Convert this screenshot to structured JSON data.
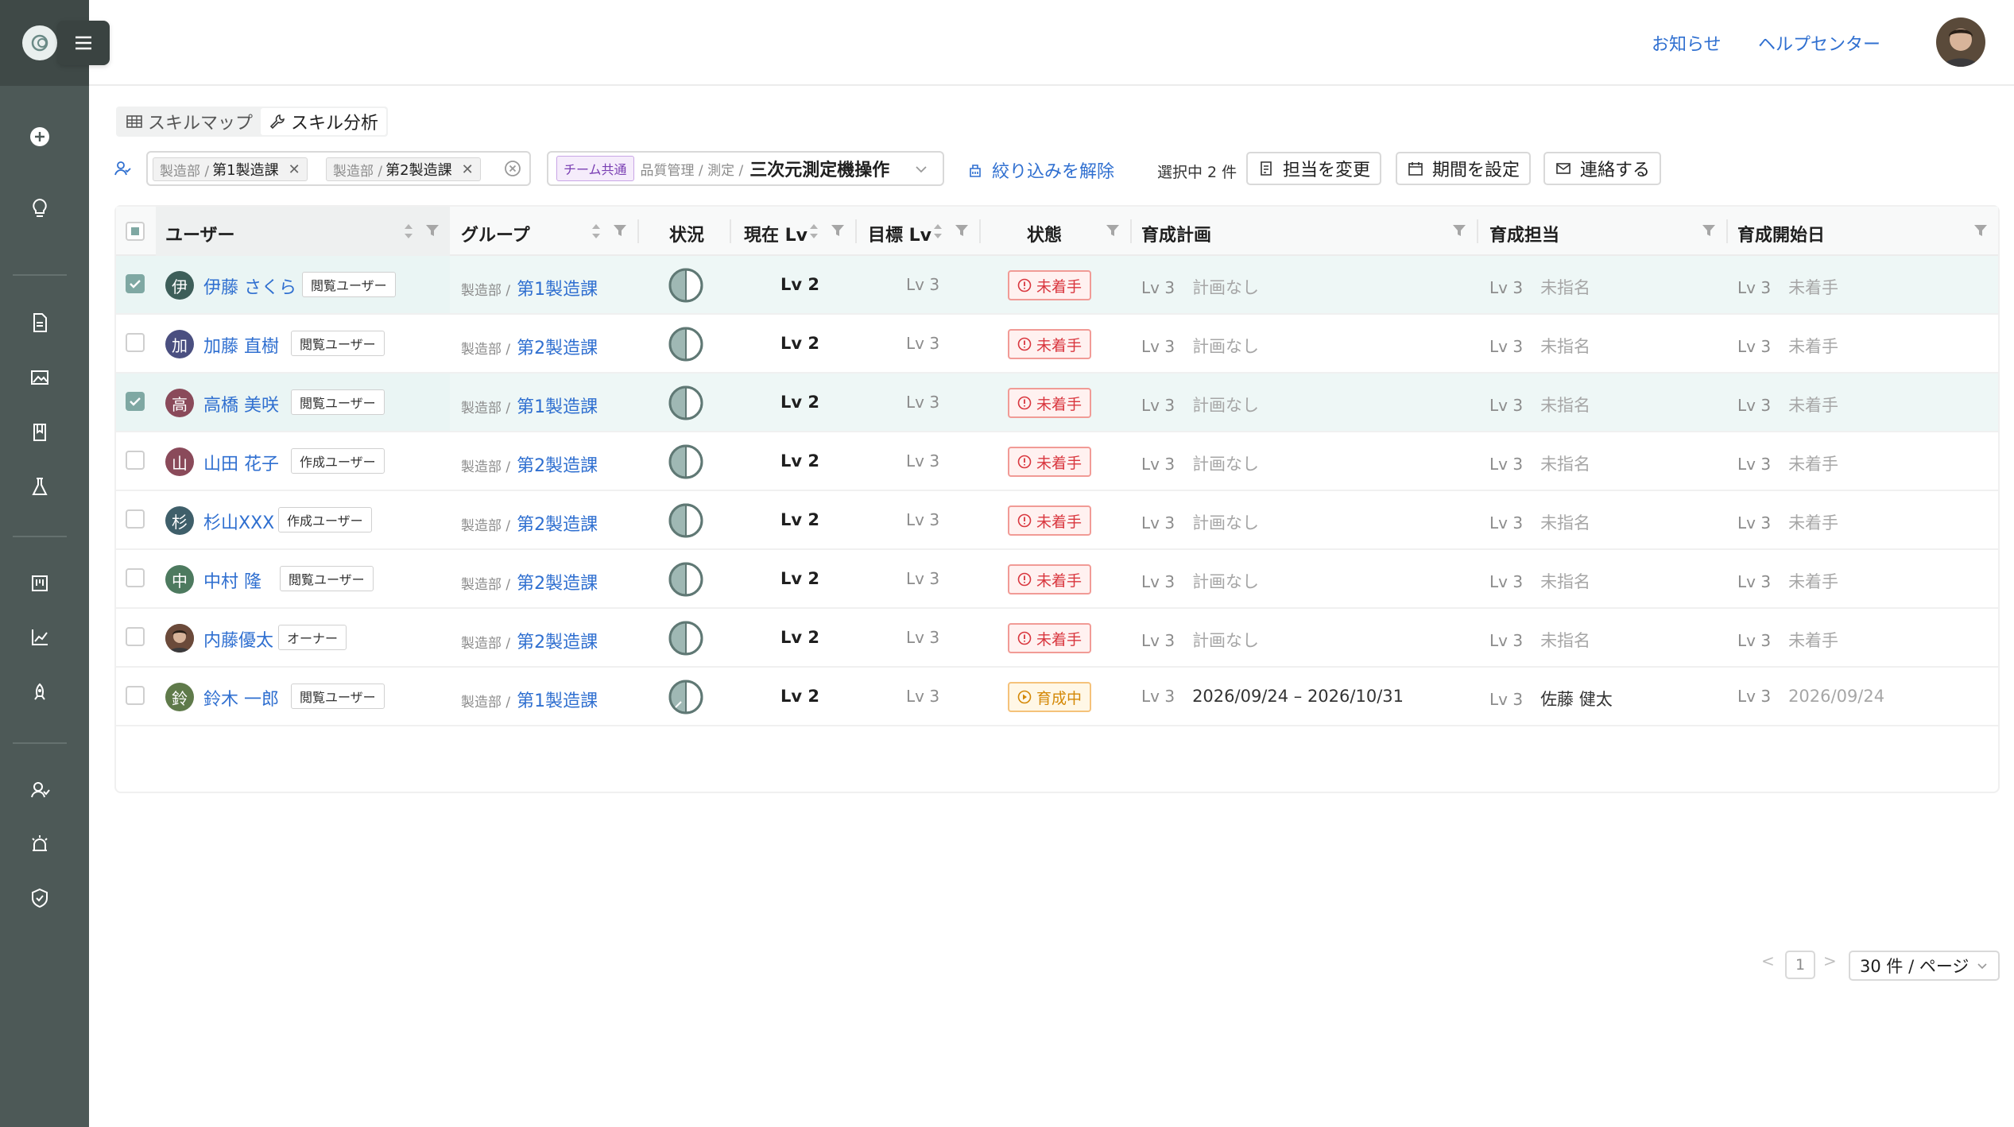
{
  "header": {
    "notice_label": "お知らせ",
    "help_label": "ヘルプセンター"
  },
  "tabs": [
    {
      "label": "スキルマップ"
    },
    {
      "label": "スキル分析"
    }
  ],
  "filters": {
    "group_chips": [
      {
        "path": "製造部 /",
        "name": "第1製造課"
      },
      {
        "path": "製造部 /",
        "name": "第2製造課"
      }
    ],
    "skill": {
      "badge": "チーム共通",
      "path": "品質管理 / 測定 /",
      "name": "三次元測定機操作"
    },
    "reset_label": "絞り込みを解除"
  },
  "actions": {
    "selected_count": "選択中 2 件",
    "change_owner": "担当を変更",
    "set_period": "期間を設定",
    "contact": "連絡する"
  },
  "table": {
    "columns": [
      "ユーザー",
      "グループ",
      "状況",
      "現在 Lv",
      "目標 Lv",
      "状態",
      "育成計画",
      "育成担当",
      "育成開始日"
    ],
    "rows": [
      {
        "initial": "伊",
        "name": "伊藤 さくら",
        "role": "閲覧ユーザー",
        "dept": "製造部 /",
        "group": "第1製造課",
        "current": "Lv 2",
        "target": "Lv 3",
        "status": "未着手",
        "plan_lv": "Lv 3",
        "plan": "計画なし",
        "owner_lv": "Lv 3",
        "owner": "未指名",
        "start_lv": "Lv 3",
        "start": "未着手",
        "selected": true,
        "progress": 0.5,
        "avatar_color": "#3d5e59"
      },
      {
        "initial": "加",
        "name": "加藤 直樹",
        "role": "閲覧ユーザー",
        "dept": "製造部 /",
        "group": "第2製造課",
        "current": "Lv 2",
        "target": "Lv 3",
        "status": "未着手",
        "plan_lv": "Lv 3",
        "plan": "計画なし",
        "owner_lv": "Lv 3",
        "owner": "未指名",
        "start_lv": "Lv 3",
        "start": "未着手",
        "selected": false,
        "progress": 0.5,
        "avatar_color": "#4a4f80"
      },
      {
        "initial": "高",
        "name": "高橋 美咲",
        "role": "閲覧ユーザー",
        "dept": "製造部 /",
        "group": "第1製造課",
        "current": "Lv 2",
        "target": "Lv 3",
        "status": "未着手",
        "plan_lv": "Lv 3",
        "plan": "計画なし",
        "owner_lv": "Lv 3",
        "owner": "未指名",
        "start_lv": "Lv 3",
        "start": "未着手",
        "selected": true,
        "progress": 0.5,
        "avatar_color": "#8a4a5a"
      },
      {
        "initial": "山",
        "name": "山田 花子",
        "role": "作成ユーザー",
        "dept": "製造部 /",
        "group": "第2製造課",
        "current": "Lv 2",
        "target": "Lv 3",
        "status": "未着手",
        "plan_lv": "Lv 3",
        "plan": "計画なし",
        "owner_lv": "Lv 3",
        "owner": "未指名",
        "start_lv": "Lv 3",
        "start": "未着手",
        "selected": false,
        "progress": 0.5,
        "avatar_color": "#8a4a5a"
      },
      {
        "initial": "杉",
        "name": "杉山XXX",
        "role": "作成ユーザー",
        "dept": "製造部 /",
        "group": "第2製造課",
        "current": "Lv 2",
        "target": "Lv 3",
        "status": "未着手",
        "plan_lv": "Lv 3",
        "plan": "計画なし",
        "owner_lv": "Lv 3",
        "owner": "未指名",
        "start_lv": "Lv 3",
        "start": "未着手",
        "selected": false,
        "progress": 0.5,
        "avatar_color": "#3f5f6a"
      },
      {
        "initial": "中",
        "name": "中村 隆",
        "role": "閲覧ユーザー",
        "dept": "製造部 /",
        "group": "第2製造課",
        "current": "Lv 2",
        "target": "Lv 3",
        "status": "未着手",
        "plan_lv": "Lv 3",
        "plan": "計画なし",
        "owner_lv": "Lv 3",
        "owner": "未指名",
        "start_lv": "Lv 3",
        "start": "未着手",
        "selected": false,
        "progress": 0.5,
        "avatar_color": "#4d7a5f"
      },
      {
        "initial": "",
        "name": "内藤優太",
        "role": "オーナー",
        "dept": "製造部 /",
        "group": "第2製造課",
        "current": "Lv 2",
        "target": "Lv 3",
        "status": "未着手",
        "plan_lv": "Lv 3",
        "plan": "計画なし",
        "owner_lv": "Lv 3",
        "owner": "未指名",
        "start_lv": "Lv 3",
        "start": "未着手",
        "selected": false,
        "progress": 0.5,
        "avatar_color": "#6b4a3a",
        "photo": true
      },
      {
        "initial": "鈴",
        "name": "鈴木 一郎",
        "role": "閲覧ユーザー",
        "dept": "製造部 /",
        "group": "第1製造課",
        "current": "Lv 2",
        "target": "Lv 3",
        "status": "育成中",
        "plan_lv": "Lv 3",
        "plan": "2026/09/24 – 2026/10/31",
        "owner_lv": "Lv 3",
        "owner": "佐藤 健太",
        "start_lv": "Lv 3",
        "start": "2026/09/24",
        "selected": false,
        "progress": 0.5,
        "avatar_color": "#5f7a4a",
        "in_progress": true
      }
    ]
  },
  "pagination": {
    "page": "1",
    "page_size": "30 件 / ページ",
    "prev": "<",
    "next": ">"
  },
  "colors": {
    "accent": "#2f6fd0",
    "sidebar": "#4d5957",
    "selected_row": "#eef7f6"
  }
}
